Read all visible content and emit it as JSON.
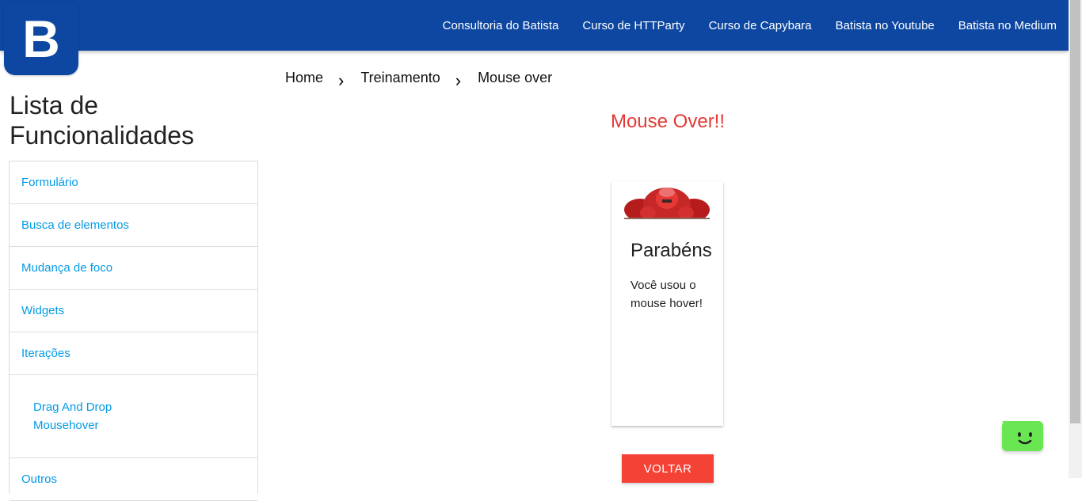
{
  "logo": {
    "letter": "B"
  },
  "nav": {
    "items": [
      {
        "label": "Consultoria do Batista"
      },
      {
        "label": "Curso de HTTParty"
      },
      {
        "label": "Curso de Capybara"
      },
      {
        "label": "Batista no Youtube"
      },
      {
        "label": "Batista no Medium"
      }
    ]
  },
  "sidebar": {
    "title": "Lista de Funcionalidades",
    "items": [
      {
        "label": "Formulário"
      },
      {
        "label": "Busca de elementos"
      },
      {
        "label": "Mudança de foco"
      },
      {
        "label": "Widgets"
      },
      {
        "label": "Iterações"
      }
    ],
    "subitems": [
      {
        "label": "Drag And Drop"
      },
      {
        "label": "Mousehover"
      }
    ],
    "last_item": {
      "label": "Outros"
    }
  },
  "breadcrumb": {
    "items": [
      {
        "label": "Home"
      },
      {
        "label": "Treinamento"
      },
      {
        "label": "Mouse over"
      }
    ],
    "separator_icon": "chevron-right-icon"
  },
  "main": {
    "title": "Mouse Over!!",
    "card": {
      "title": "Parabéns",
      "text": "Você usou o mouse hover!"
    },
    "back_button": "VOLTAR"
  },
  "chat_widget": {
    "icon": "smiley-chat-icon"
  },
  "colors": {
    "header": "#0d47a1",
    "link": "#039be5",
    "title_red": "#e53935",
    "button_red": "#f44336",
    "chat_green": "#69e651"
  }
}
